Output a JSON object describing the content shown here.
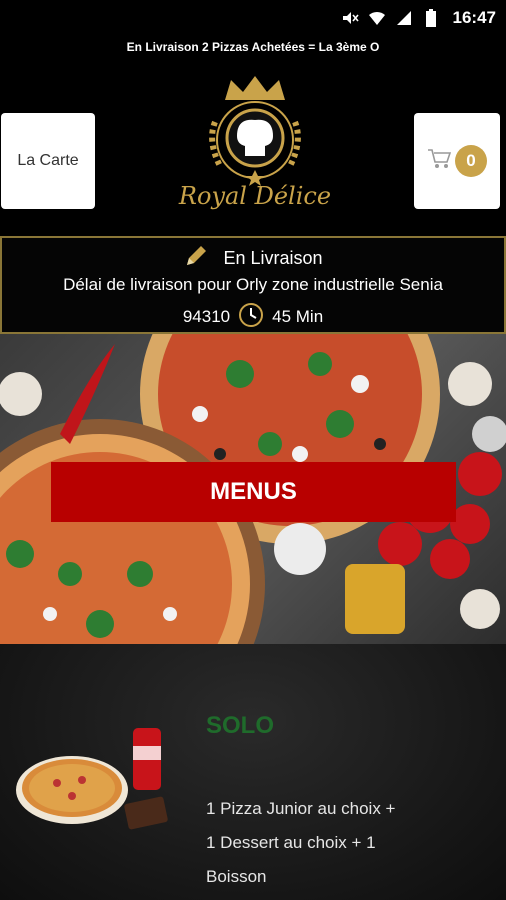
{
  "status": {
    "time": "16:47"
  },
  "marquee": "En Livraison 2 Pizzas Achetées = La 3ème O",
  "header": {
    "carte_label": "La Carte",
    "cart_count": "0",
    "logo_text": "Royal Délice"
  },
  "delivery": {
    "mode": "En Livraison",
    "line2": "Délai de livraison pour Orly zone industrielle Senia",
    "postcode": "94310",
    "duration": "45 Min"
  },
  "hero": {
    "menus_label": "MENUS"
  },
  "solo": {
    "title": "SOLO",
    "description": "1 Pizza Junior au choix + 1 Dessert au choix + 1 Boisson"
  },
  "colors": {
    "gold": "#c9a34a",
    "red": "#b80000",
    "green": "#1f6b2b"
  }
}
